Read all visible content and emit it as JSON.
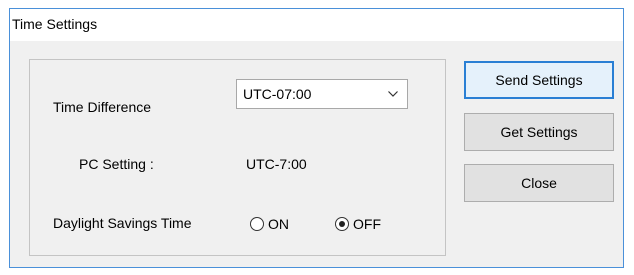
{
  "window": {
    "title": "Time Settings"
  },
  "form": {
    "time_difference_label": "Time Difference",
    "time_difference_value": "UTC-07:00",
    "pc_setting_label": "PC Setting :",
    "pc_setting_value": "UTC-7:00",
    "dst_label": "Daylight Savings Time",
    "dst_options": [
      {
        "label": "ON",
        "selected": false
      },
      {
        "label": "OFF",
        "selected": true
      }
    ]
  },
  "buttons": {
    "send": "Send Settings",
    "get": "Get Settings",
    "close": "Close"
  },
  "colors": {
    "accent": "#2a7fd4",
    "window_border": "#4a90d9",
    "panel_bg": "#f0f0f0",
    "button_bg": "#e1e1e1"
  }
}
